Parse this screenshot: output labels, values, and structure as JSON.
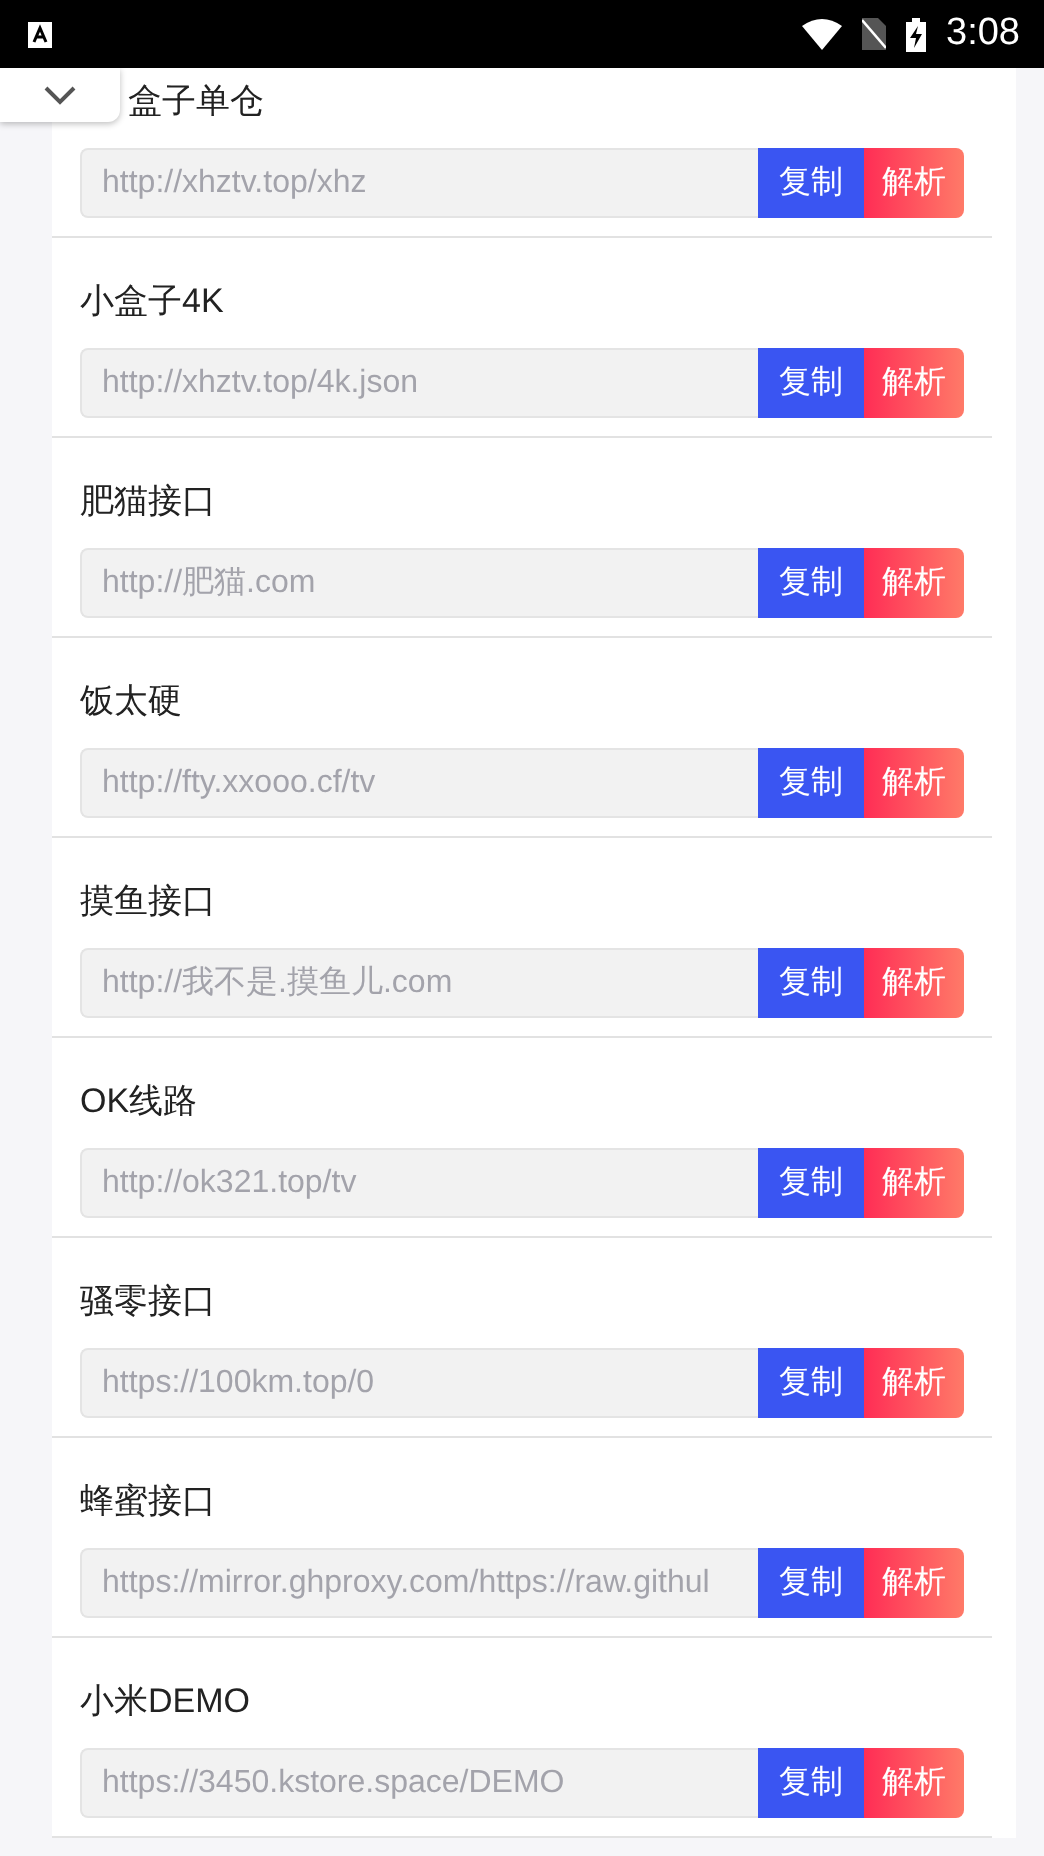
{
  "status_bar": {
    "time": "3:08"
  },
  "entries": [
    {
      "title": "盒子单仓",
      "url": "http://xhztv.top/xhz",
      "copy": "复制",
      "parse": "解析"
    },
    {
      "title": "小盒子4K",
      "url": "http://xhztv.top/4k.json",
      "copy": "复制",
      "parse": "解析"
    },
    {
      "title": "肥猫接口",
      "url": "http://肥猫.com",
      "copy": "复制",
      "parse": "解析"
    },
    {
      "title": "饭太硬",
      "url": "http://fty.xxooo.cf/tv",
      "copy": "复制",
      "parse": "解析"
    },
    {
      "title": "摸鱼接口",
      "url": "http://我不是.摸鱼儿.com",
      "copy": "复制",
      "parse": "解析"
    },
    {
      "title": "OK线路",
      "url": "http://ok321.top/tv",
      "copy": "复制",
      "parse": "解析"
    },
    {
      "title": "骚零接口",
      "url": "https://100km.top/0",
      "copy": "复制",
      "parse": "解析"
    },
    {
      "title": "蜂蜜接口",
      "url": "https://mirror.ghproxy.com/https://raw.githul",
      "copy": "复制",
      "parse": "解析"
    },
    {
      "title": "小米DEMO",
      "url": "https://3450.kstore.space/DEMO",
      "copy": "复制",
      "parse": "解析"
    }
  ]
}
